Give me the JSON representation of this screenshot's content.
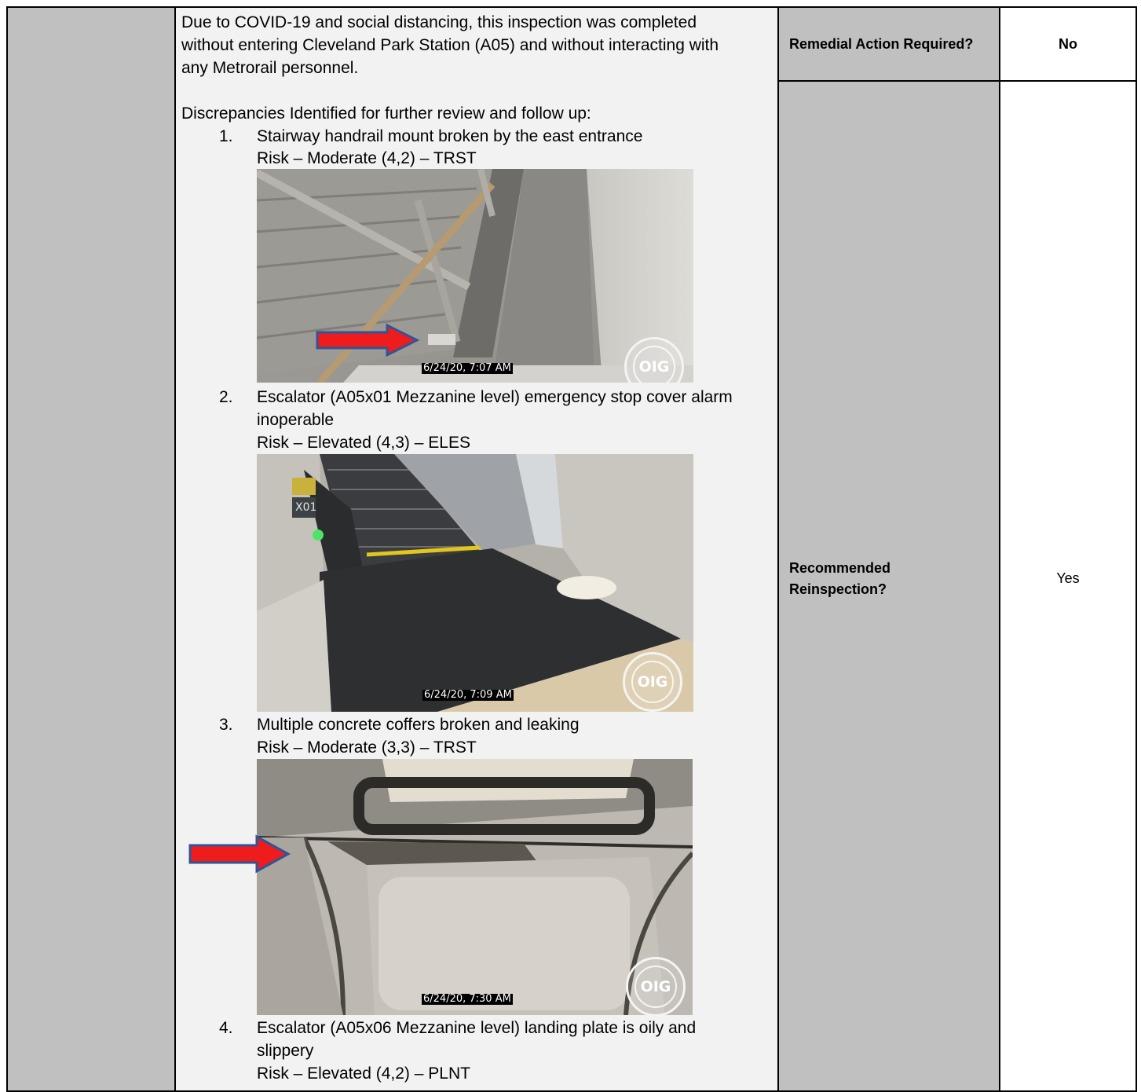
{
  "intro": {
    "line1": "Due to COVID-19 and social distancing, this inspection was completed",
    "line2": "without entering Cleveland Park Station (A05) and without interacting with",
    "line3": "any Metrorail personnel."
  },
  "heading": "Discrepancies Identified for further review and follow up:",
  "items": [
    {
      "num": "1.",
      "desc_lines": [
        "Stairway handrail mount broken by the east entrance"
      ],
      "risk": "Risk – Moderate (4,2) – TRST",
      "timestamp": "6/24/20, 7:07 AM",
      "icon": "handrail-photo"
    },
    {
      "num": "2.",
      "desc_lines": [
        "Escalator (A05x01 Mezzanine level) emergency stop cover alarm",
        "inoperable"
      ],
      "risk": "Risk – Elevated (4,3) – ELES",
      "timestamp": "6/24/20, 7:09 AM",
      "icon": "escalator-photo"
    },
    {
      "num": "3.",
      "desc_lines": [
        "Multiple concrete coffers broken and leaking"
      ],
      "risk": "Risk – Moderate (3,3) – TRST",
      "timestamp": "6/24/20, 7:30 AM",
      "icon": "coffer-photo"
    },
    {
      "num": "4.",
      "desc_lines": [
        "Escalator (A05x06 Mezzanine level) landing plate is oily and",
        "slippery"
      ],
      "risk": "Risk – Elevated (4,2) – PLNT"
    }
  ],
  "photo_labels": {
    "escalator_id": "X01"
  },
  "seal_text": "OIG",
  "side": {
    "remedial_label": "Remedial Action Required?",
    "remedial_value": "No",
    "reinspection_label_1": "Recommended",
    "reinspection_label_2": "Reinspection?",
    "reinspection_value": "Yes"
  },
  "colors": {
    "cell_gray": "#c0c0c0",
    "text_cell": "#f2f2f2",
    "arrow_fill": "#ee1c1c",
    "arrow_border": "#2f5597"
  }
}
